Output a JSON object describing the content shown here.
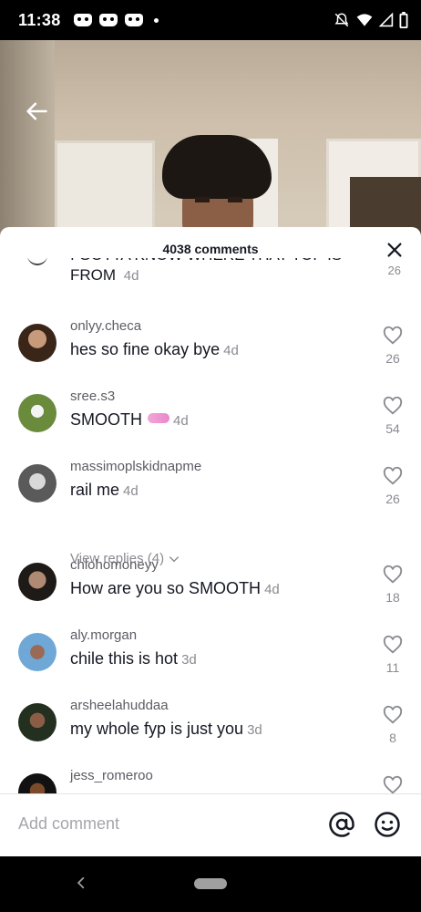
{
  "status": {
    "time": "11:38"
  },
  "sheet": {
    "title": "4038 comments"
  },
  "partial_comment": {
    "text": "I GOTTA KNOW WHERE THAT TOP IS",
    "text2": "FROM",
    "time": "4d",
    "likes": "26"
  },
  "comments": [
    {
      "username": "onlyy.checa",
      "text": "hes so fine okay bye",
      "time": "4d",
      "likes": "26"
    },
    {
      "username": "sree.s3",
      "text": "SMOOTH",
      "time": "4d",
      "likes": "54"
    },
    {
      "username": "massimoplskidnapme",
      "text": "rail me",
      "time": "4d",
      "likes": "26"
    },
    {
      "username": "chlohomoneyy",
      "text": "How are you so SMOOTH",
      "time": "4d",
      "likes": "18"
    },
    {
      "username": "aly.morgan",
      "text": "chile this is hot",
      "time": "3d",
      "likes": "11"
    },
    {
      "username": "arsheelahuddaa",
      "text": "my whole fyp is just you",
      "time": "3d",
      "likes": "8"
    },
    {
      "username": "jess_romeroo"
    }
  ],
  "view_replies": "View replies (4)",
  "input": {
    "placeholder": "Add comment"
  },
  "colors": {
    "text": "#161823",
    "secondary": "#8a8b91",
    "background": "#ffffff"
  }
}
